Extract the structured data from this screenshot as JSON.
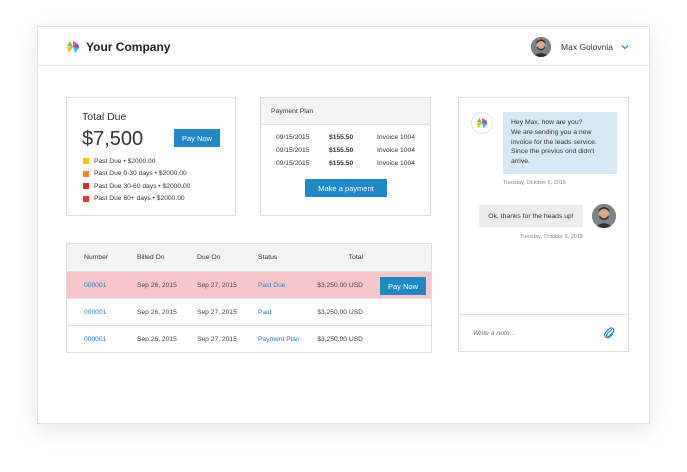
{
  "header": {
    "brand": "Your Company",
    "user_name": "Max Golovnia"
  },
  "total_due": {
    "label": "Total Due",
    "amount": "$7,500",
    "pay_label": "Pay Now",
    "legend": [
      {
        "label": "Past Due • $2000.00",
        "color": "#f5c400"
      },
      {
        "label": "Past Due 0-30 days • $2000.00",
        "color": "#f08b1e"
      },
      {
        "label": "Past Due 30-60 days • $2000.00",
        "color": "#c0392b"
      },
      {
        "label": "Past Due 60+ days • $2000.00",
        "color": "#e53935"
      }
    ]
  },
  "payment_plan": {
    "title": "Payment Plan",
    "rows": [
      {
        "date": "09/15/2015",
        "amount": "$155.50",
        "invoice": "Invoice 1004"
      },
      {
        "date": "09/15/2015",
        "amount": "$155.50",
        "invoice": "Invoice 1004"
      },
      {
        "date": "09/15/2015",
        "amount": "$155.50",
        "invoice": "Invoice 1004"
      }
    ],
    "button_label": "Make a payment"
  },
  "invoices": {
    "columns": [
      "Number",
      "Billed On",
      "Due On",
      "Status",
      "Total"
    ],
    "rows": [
      {
        "number": "000001",
        "billed": "Sep 26, 2015",
        "due": "Sep 27, 2015",
        "status": "Past Due",
        "total": "$3,250.00 USD",
        "action": "Pay Now"
      },
      {
        "number": "000001",
        "billed": "Sep 26, 2015",
        "due": "Sep 27, 2015",
        "status": "Paid",
        "total": "$3,250.00 USD"
      },
      {
        "number": "000001",
        "billed": "Sep 26, 2015",
        "due": "Sep 27, 2015",
        "status": "Payment Plan",
        "total": "$3,250.00 USD"
      }
    ]
  },
  "chat": {
    "messages": [
      {
        "from": "company",
        "lines": [
          "Hey Max, how are you?",
          "We are sending you a new",
          "invoice for the leads service.",
          "Since the previus ond didn't",
          "arrive."
        ],
        "time": "Tuesday, October 6, 2015"
      },
      {
        "from": "user",
        "lines": [
          "Ok, thanks for the heads up!"
        ],
        "time": "Tuesday, October 6, 2015"
      }
    ],
    "input_placeholder": "Write a note...",
    "attach_icon": "paperclip-icon"
  },
  "colors": {
    "accent": "#1e88c8",
    "link": "#1e7fc0",
    "past_due_row": "#f8c6c9",
    "incoming_bubble": "#d4e9f5"
  }
}
